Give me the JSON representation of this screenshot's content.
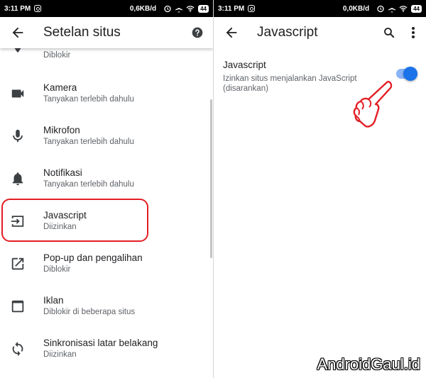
{
  "status_left": {
    "time": "3:11 PM",
    "speed": "0,6KB/d",
    "battery": "44"
  },
  "status_right": {
    "time": "3:11 PM",
    "speed": "0,0KB/d",
    "battery": "44"
  },
  "left_screen": {
    "title": "Setelan situs",
    "items": [
      {
        "label": "",
        "sub": "Diblokir",
        "icon": "location-icon"
      },
      {
        "label": "Kamera",
        "sub": "Tanyakan terlebih dahulu",
        "icon": "camera-icon"
      },
      {
        "label": "Mikrofon",
        "sub": "Tanyakan terlebih dahulu",
        "icon": "microphone-icon"
      },
      {
        "label": "Notifikasi",
        "sub": "Tanyakan terlebih dahulu",
        "icon": "bell-icon"
      },
      {
        "label": "Javascript",
        "sub": "Diizinkan",
        "icon": "javascript-icon"
      },
      {
        "label": "Pop-up dan pengalihan",
        "sub": "Diblokir",
        "icon": "popup-icon"
      },
      {
        "label": "Iklan",
        "sub": "Diblokir di beberapa situs",
        "icon": "ads-icon"
      },
      {
        "label": "Sinkronisasi latar belakang",
        "sub": "Diizinkan",
        "icon": "sync-icon"
      }
    ]
  },
  "right_screen": {
    "title": "Javascript",
    "setting_title": "Javascript",
    "setting_desc": "Izinkan situs menjalankan JavaScript (disarankan)",
    "toggle_on": true
  },
  "watermark": "AndroidGaul.id",
  "colors": {
    "accent": "#1a73e8",
    "highlight": "#e31e24",
    "text": "#202124",
    "subtext": "#5f6368"
  }
}
